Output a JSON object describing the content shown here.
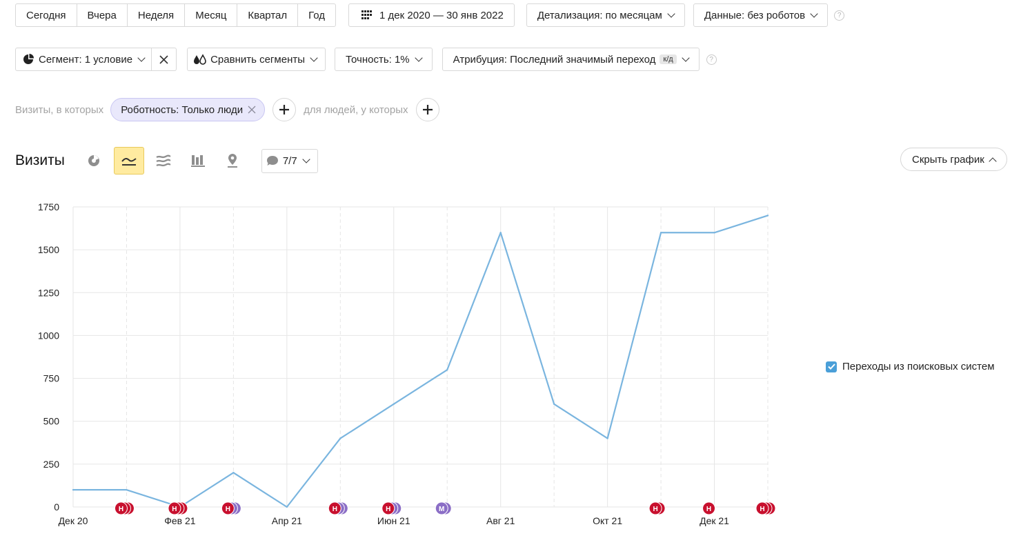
{
  "periods": [
    "Сегодня",
    "Вчера",
    "Неделя",
    "Месяц",
    "Квартал",
    "Год"
  ],
  "date_range": "1 дек 2020 — 30 янв 2022",
  "detail": "Детализация: по месяцам",
  "data_filter": "Данные: без роботов",
  "help_glyph": "?",
  "segment": "Сегмент: 1 условие",
  "compare": "Сравнить сегменты",
  "accuracy": "Точность: 1%",
  "attribution": "Атрибуция: Последний значимый переход",
  "attribution_badge": "к/д",
  "filter": {
    "visits_label": "Визиты, в которых",
    "chip": "Роботность: Только люди",
    "people_label": "для людей, у которых"
  },
  "chart_header": {
    "title": "Визиты",
    "annotations": "7/7",
    "hide_label": "Скрыть график"
  },
  "legend_label": "Переходы из поисковых систем",
  "colors": {
    "line": "#7ab5df",
    "annot_red": "#c8102e",
    "annot_purple": "#8b6ec6",
    "checkbox": "#4a9fd8"
  },
  "chart_data": {
    "type": "line",
    "x": [
      "Дек 20",
      "Янв 21",
      "Фев 21",
      "Мар 21",
      "Апр 21",
      "Май 21",
      "Июн 21",
      "Июл 21",
      "Авг 21",
      "Сен 21",
      "Окт 21",
      "Ноя 21",
      "Дек 21",
      "Янв 22"
    ],
    "x_tick_labels": [
      "Дек 20",
      "",
      "Фев 21",
      "",
      "Апр 21",
      "",
      "Июн 21",
      "",
      "Авг 21",
      "",
      "Окт 21",
      "",
      "Дек 21",
      ""
    ],
    "series": [
      {
        "name": "Переходы из поисковых систем",
        "values": [
          100,
          100,
          0,
          200,
          0,
          400,
          600,
          800,
          1600,
          600,
          400,
          1600,
          1600,
          1700
        ]
      }
    ],
    "y_ticks": [
      0,
      250,
      500,
      750,
      1000,
      1250,
      1500,
      1750
    ],
    "ylim": [
      0,
      1750
    ],
    "grid": true,
    "annotations": [
      {
        "month_index": 1,
        "letter": "Н",
        "kind": "red",
        "stack": 3
      },
      {
        "month_index": 2,
        "letter": "Н",
        "kind": "red",
        "stack": 3
      },
      {
        "month_index": 3,
        "letter": "Н",
        "kind": "mixed",
        "stack": 3
      },
      {
        "month_index": 5,
        "letter": "Н",
        "kind": "mixed",
        "stack": 3
      },
      {
        "month_index": 6,
        "letter": "Н",
        "kind": "mixed",
        "stack": 3
      },
      {
        "month_index": 7,
        "letter": "М",
        "kind": "purple",
        "stack": 2
      },
      {
        "month_index": 11,
        "letter": "Н",
        "kind": "red",
        "stack": 2
      },
      {
        "month_index": 12,
        "letter": "Н",
        "kind": "red",
        "stack": 1
      },
      {
        "month_index": 13,
        "letter": "Н",
        "kind": "red",
        "stack": 3
      }
    ]
  }
}
